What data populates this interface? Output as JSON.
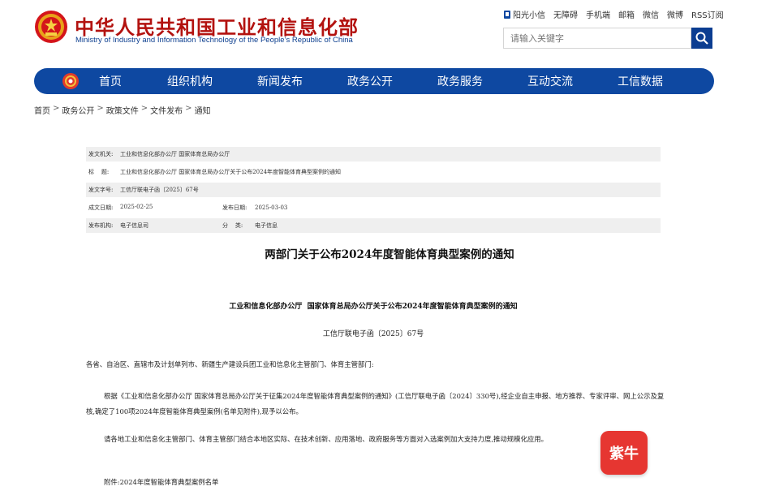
{
  "header": {
    "site_title": "中华人民共和国工业和信息化部",
    "site_subtitle": "Ministry of Industry and Information Technology of the People’s Republic of China",
    "emblem_icon": "national-emblem-icon",
    "top_links": [
      "阳光小信",
      "无障碍",
      "手机端",
      "邮箱",
      "微信",
      "微博",
      "RSS订阅"
    ],
    "search": {
      "placeholder": "请输入关键字"
    }
  },
  "nav": {
    "items": [
      "首页",
      "组织机构",
      "新闻发布",
      "政务公开",
      "政务服务",
      "互动交流",
      "工信数据"
    ],
    "bg_color": "#0e48a1"
  },
  "breadcrumb": [
    "首页",
    "政务公开",
    "政策文件",
    "文件发布",
    "通知"
  ],
  "meta": {
    "issuer_label": "发文机关:",
    "issuer_value": "工业和信息化部办公厅 国家体育总局办公厅",
    "title_label": "标    题:",
    "title_value": "工业和信息化部办公厅 国家体育总局办公厅关于公布2024年度智能体育典型案例的通知",
    "docno_label": "发文字号:",
    "docno_value": "工信厅联电子函〔2025〕67号",
    "created_label": "成文日期:",
    "created_value": "2025-02-25",
    "published_label": "发布日期:",
    "published_value": "2025-03-03",
    "org_label": "发布机构:",
    "org_value": "电子信息司",
    "category_label": "分    类:",
    "category_value": "电子信息"
  },
  "article": {
    "title": "两部门关于公布2024年度智能体育典型案例的通知",
    "issuer_line": "工业和信息化部办公厅  国家体育总局办公厅关于公布2024年度智能体育典型案例的通知",
    "doc_number": "工信厅联电子函〔2025〕67号",
    "para1": "各省、自治区、直辖市及计划单列市、新疆生产建设兵团工业和信息化主管部门、体育主管部门:",
    "para2": "根据《工业和信息化部办公厅 国家体育总局办公厅关于征集2024年度智能体育典型案例的通知》(工信厅联电子函〔2024〕330号),经企业自主申报、地方推荐、专家评审、网上公示及复核,确定了100项2024年度智能体育典型案例(名单见附件),现予以公布。",
    "para3": "请各地工业和信息化主管部门、体育主管部门结合本地区实际、在技术创新、应用落地、政府服务等方面对入选案例加大支持力度,推动规模化应用。",
    "para4": "附件:2024年度智能体育典型案例名单"
  },
  "badge": {
    "label": "紫牛",
    "color": "#e63631"
  }
}
